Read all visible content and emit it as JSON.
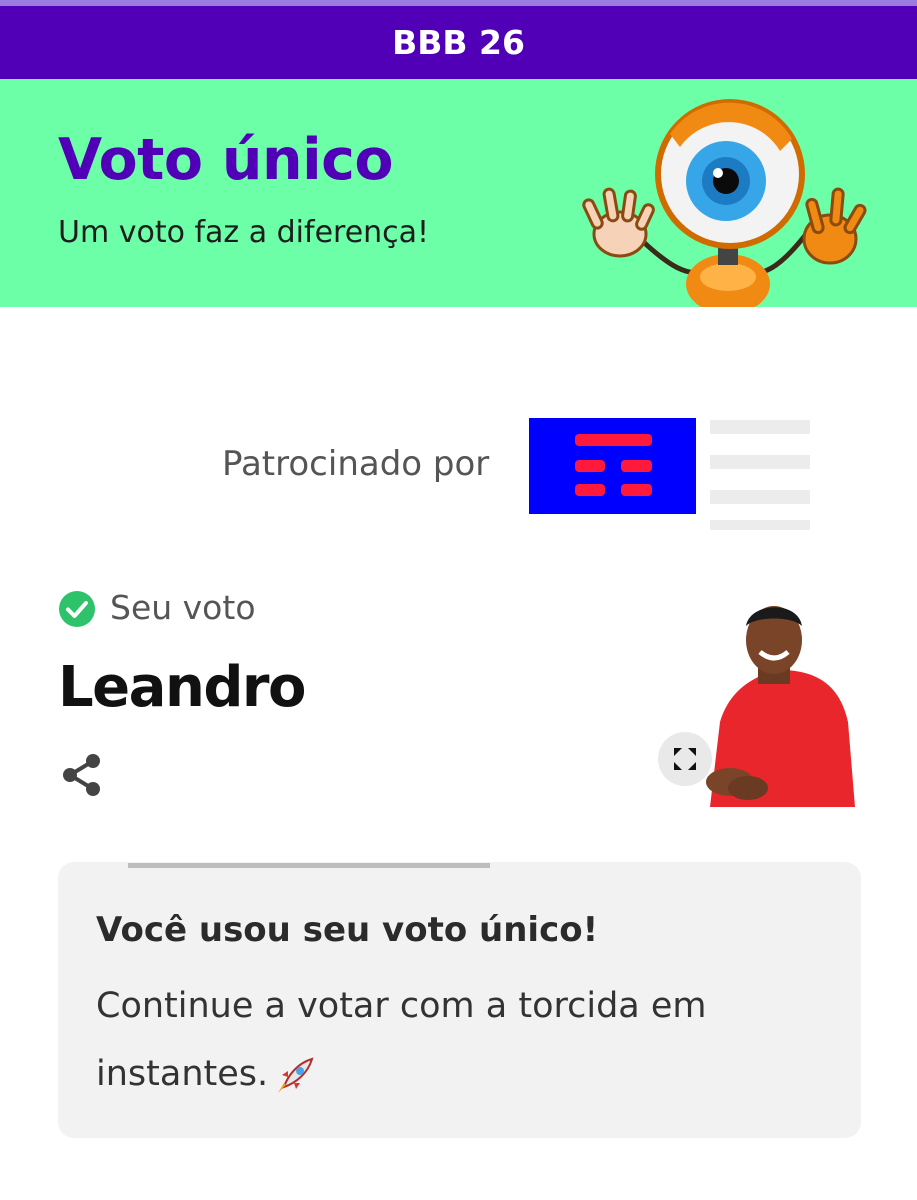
{
  "app_bar": {
    "title": "BBB 26"
  },
  "hero": {
    "title": "Voto único",
    "subtitle": "Um voto faz a diferença!",
    "mascot_icon": "big-brother-eye-robot"
  },
  "sponsor": {
    "label": "Patrocinado por",
    "logo_color": "#0000ff",
    "logo_bars_color": "#ff1a3c"
  },
  "vote": {
    "status_label": "Seu voto",
    "status_icon": "check-circle-icon",
    "status_color": "#2ec26b",
    "name": "Leandro",
    "share_icon": "share-icon",
    "expand_icon": "expand-icon"
  },
  "info_card": {
    "title": "Você usou seu voto único!",
    "body": "Continue a votar com a torcida em instantes.",
    "emoji_icon": "rocket-icon"
  },
  "colors": {
    "brand_purple": "#5200b8",
    "hero_green": "#6dffa8"
  }
}
